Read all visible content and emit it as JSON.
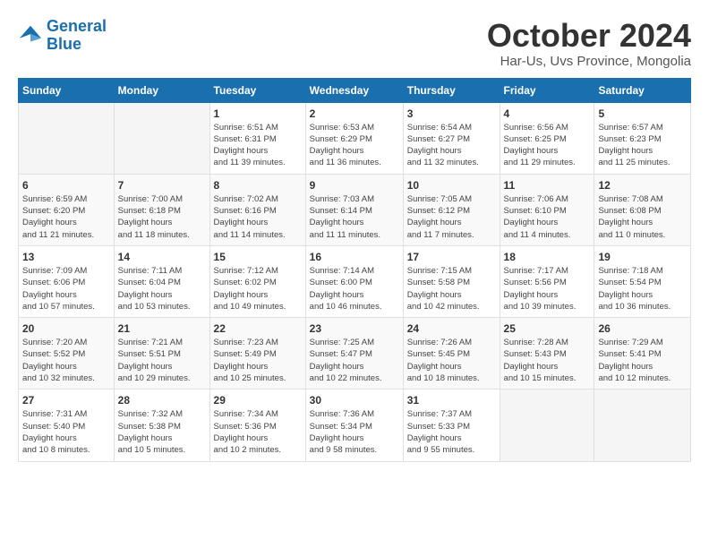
{
  "header": {
    "logo_line1": "General",
    "logo_line2": "Blue",
    "month_title": "October 2024",
    "location": "Har-Us, Uvs Province, Mongolia"
  },
  "weekdays": [
    "Sunday",
    "Monday",
    "Tuesday",
    "Wednesday",
    "Thursday",
    "Friday",
    "Saturday"
  ],
  "weeks": [
    [
      {
        "day": "",
        "empty": true
      },
      {
        "day": "",
        "empty": true
      },
      {
        "day": "1",
        "sunrise": "6:51 AM",
        "sunset": "6:31 PM",
        "daylight": "11 hours and 39 minutes."
      },
      {
        "day": "2",
        "sunrise": "6:53 AM",
        "sunset": "6:29 PM",
        "daylight": "11 hours and 36 minutes."
      },
      {
        "day": "3",
        "sunrise": "6:54 AM",
        "sunset": "6:27 PM",
        "daylight": "11 hours and 32 minutes."
      },
      {
        "day": "4",
        "sunrise": "6:56 AM",
        "sunset": "6:25 PM",
        "daylight": "11 hours and 29 minutes."
      },
      {
        "day": "5",
        "sunrise": "6:57 AM",
        "sunset": "6:23 PM",
        "daylight": "11 hours and 25 minutes."
      }
    ],
    [
      {
        "day": "6",
        "sunrise": "6:59 AM",
        "sunset": "6:20 PM",
        "daylight": "11 hours and 21 minutes."
      },
      {
        "day": "7",
        "sunrise": "7:00 AM",
        "sunset": "6:18 PM",
        "daylight": "11 hours and 18 minutes."
      },
      {
        "day": "8",
        "sunrise": "7:02 AM",
        "sunset": "6:16 PM",
        "daylight": "11 hours and 14 minutes."
      },
      {
        "day": "9",
        "sunrise": "7:03 AM",
        "sunset": "6:14 PM",
        "daylight": "11 hours and 11 minutes."
      },
      {
        "day": "10",
        "sunrise": "7:05 AM",
        "sunset": "6:12 PM",
        "daylight": "11 hours and 7 minutes."
      },
      {
        "day": "11",
        "sunrise": "7:06 AM",
        "sunset": "6:10 PM",
        "daylight": "11 hours and 4 minutes."
      },
      {
        "day": "12",
        "sunrise": "7:08 AM",
        "sunset": "6:08 PM",
        "daylight": "11 hours and 0 minutes."
      }
    ],
    [
      {
        "day": "13",
        "sunrise": "7:09 AM",
        "sunset": "6:06 PM",
        "daylight": "10 hours and 57 minutes."
      },
      {
        "day": "14",
        "sunrise": "7:11 AM",
        "sunset": "6:04 PM",
        "daylight": "10 hours and 53 minutes."
      },
      {
        "day": "15",
        "sunrise": "7:12 AM",
        "sunset": "6:02 PM",
        "daylight": "10 hours and 49 minutes."
      },
      {
        "day": "16",
        "sunrise": "7:14 AM",
        "sunset": "6:00 PM",
        "daylight": "10 hours and 46 minutes."
      },
      {
        "day": "17",
        "sunrise": "7:15 AM",
        "sunset": "5:58 PM",
        "daylight": "10 hours and 42 minutes."
      },
      {
        "day": "18",
        "sunrise": "7:17 AM",
        "sunset": "5:56 PM",
        "daylight": "10 hours and 39 minutes."
      },
      {
        "day": "19",
        "sunrise": "7:18 AM",
        "sunset": "5:54 PM",
        "daylight": "10 hours and 36 minutes."
      }
    ],
    [
      {
        "day": "20",
        "sunrise": "7:20 AM",
        "sunset": "5:52 PM",
        "daylight": "10 hours and 32 minutes."
      },
      {
        "day": "21",
        "sunrise": "7:21 AM",
        "sunset": "5:51 PM",
        "daylight": "10 hours and 29 minutes."
      },
      {
        "day": "22",
        "sunrise": "7:23 AM",
        "sunset": "5:49 PM",
        "daylight": "10 hours and 25 minutes."
      },
      {
        "day": "23",
        "sunrise": "7:25 AM",
        "sunset": "5:47 PM",
        "daylight": "10 hours and 22 minutes."
      },
      {
        "day": "24",
        "sunrise": "7:26 AM",
        "sunset": "5:45 PM",
        "daylight": "10 hours and 18 minutes."
      },
      {
        "day": "25",
        "sunrise": "7:28 AM",
        "sunset": "5:43 PM",
        "daylight": "10 hours and 15 minutes."
      },
      {
        "day": "26",
        "sunrise": "7:29 AM",
        "sunset": "5:41 PM",
        "daylight": "10 hours and 12 minutes."
      }
    ],
    [
      {
        "day": "27",
        "sunrise": "7:31 AM",
        "sunset": "5:40 PM",
        "daylight": "10 hours and 8 minutes."
      },
      {
        "day": "28",
        "sunrise": "7:32 AM",
        "sunset": "5:38 PM",
        "daylight": "10 hours and 5 minutes."
      },
      {
        "day": "29",
        "sunrise": "7:34 AM",
        "sunset": "5:36 PM",
        "daylight": "10 hours and 2 minutes."
      },
      {
        "day": "30",
        "sunrise": "7:36 AM",
        "sunset": "5:34 PM",
        "daylight": "9 hours and 58 minutes."
      },
      {
        "day": "31",
        "sunrise": "7:37 AM",
        "sunset": "5:33 PM",
        "daylight": "9 hours and 55 minutes."
      },
      {
        "day": "",
        "empty": true
      },
      {
        "day": "",
        "empty": true
      }
    ]
  ]
}
